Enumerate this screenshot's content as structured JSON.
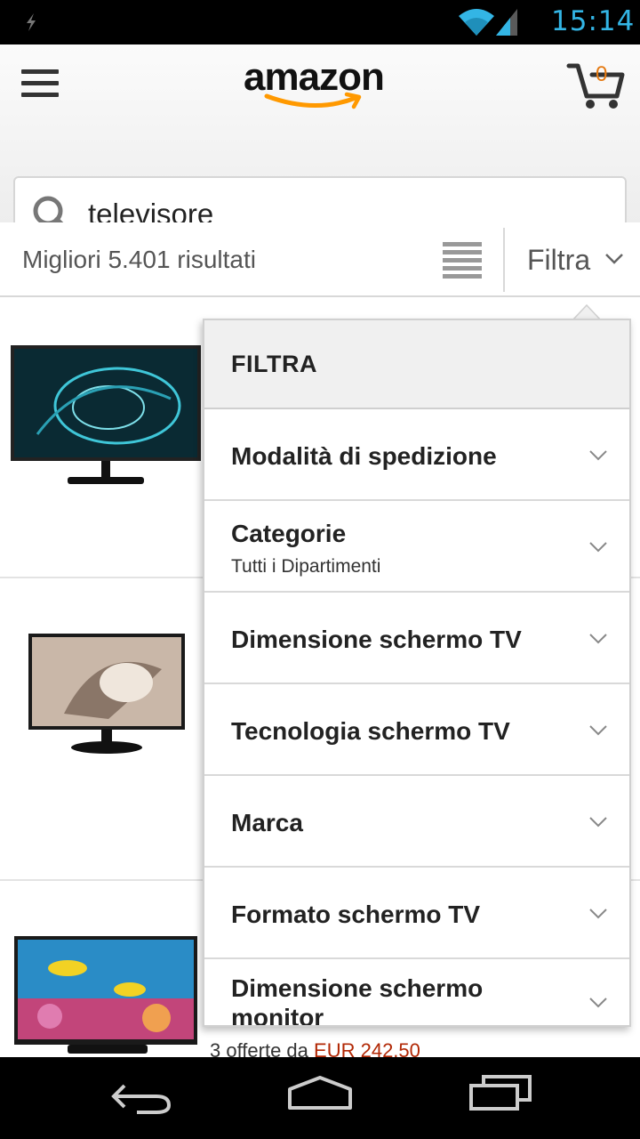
{
  "status_bar": {
    "time": "15:14"
  },
  "header": {
    "logo_text": "amazon",
    "cart_count": "0",
    "search": {
      "value": "televisore"
    }
  },
  "results": {
    "count_label": "Migliori 5.401 risultati",
    "filter_label": "Filtra"
  },
  "products": [
    {
      "image": "monitor-blue-swirl"
    },
    {
      "image": "monitor-silver-abstract"
    },
    {
      "image": "tv-coral-fish"
    }
  ],
  "offer": {
    "prefix": "3 offerte da",
    "price": "EUR 242,50"
  },
  "filter_panel": {
    "title": "FILTRA",
    "rows": [
      {
        "label": "Modalità di spedizione",
        "sub": ""
      },
      {
        "label": "Categorie",
        "sub": "Tutti i Dipartimenti"
      },
      {
        "label": "Dimensione schermo TV",
        "sub": ""
      },
      {
        "label": "Tecnologia schermo TV",
        "sub": ""
      },
      {
        "label": "Marca",
        "sub": ""
      },
      {
        "label": "Formato schermo TV",
        "sub": ""
      },
      {
        "label": "Dimensione schermo monitor",
        "sub": ""
      }
    ]
  },
  "colors": {
    "accent_orange": "#ff9900",
    "clock_blue": "#33b5e5",
    "price_red": "#b12704"
  }
}
